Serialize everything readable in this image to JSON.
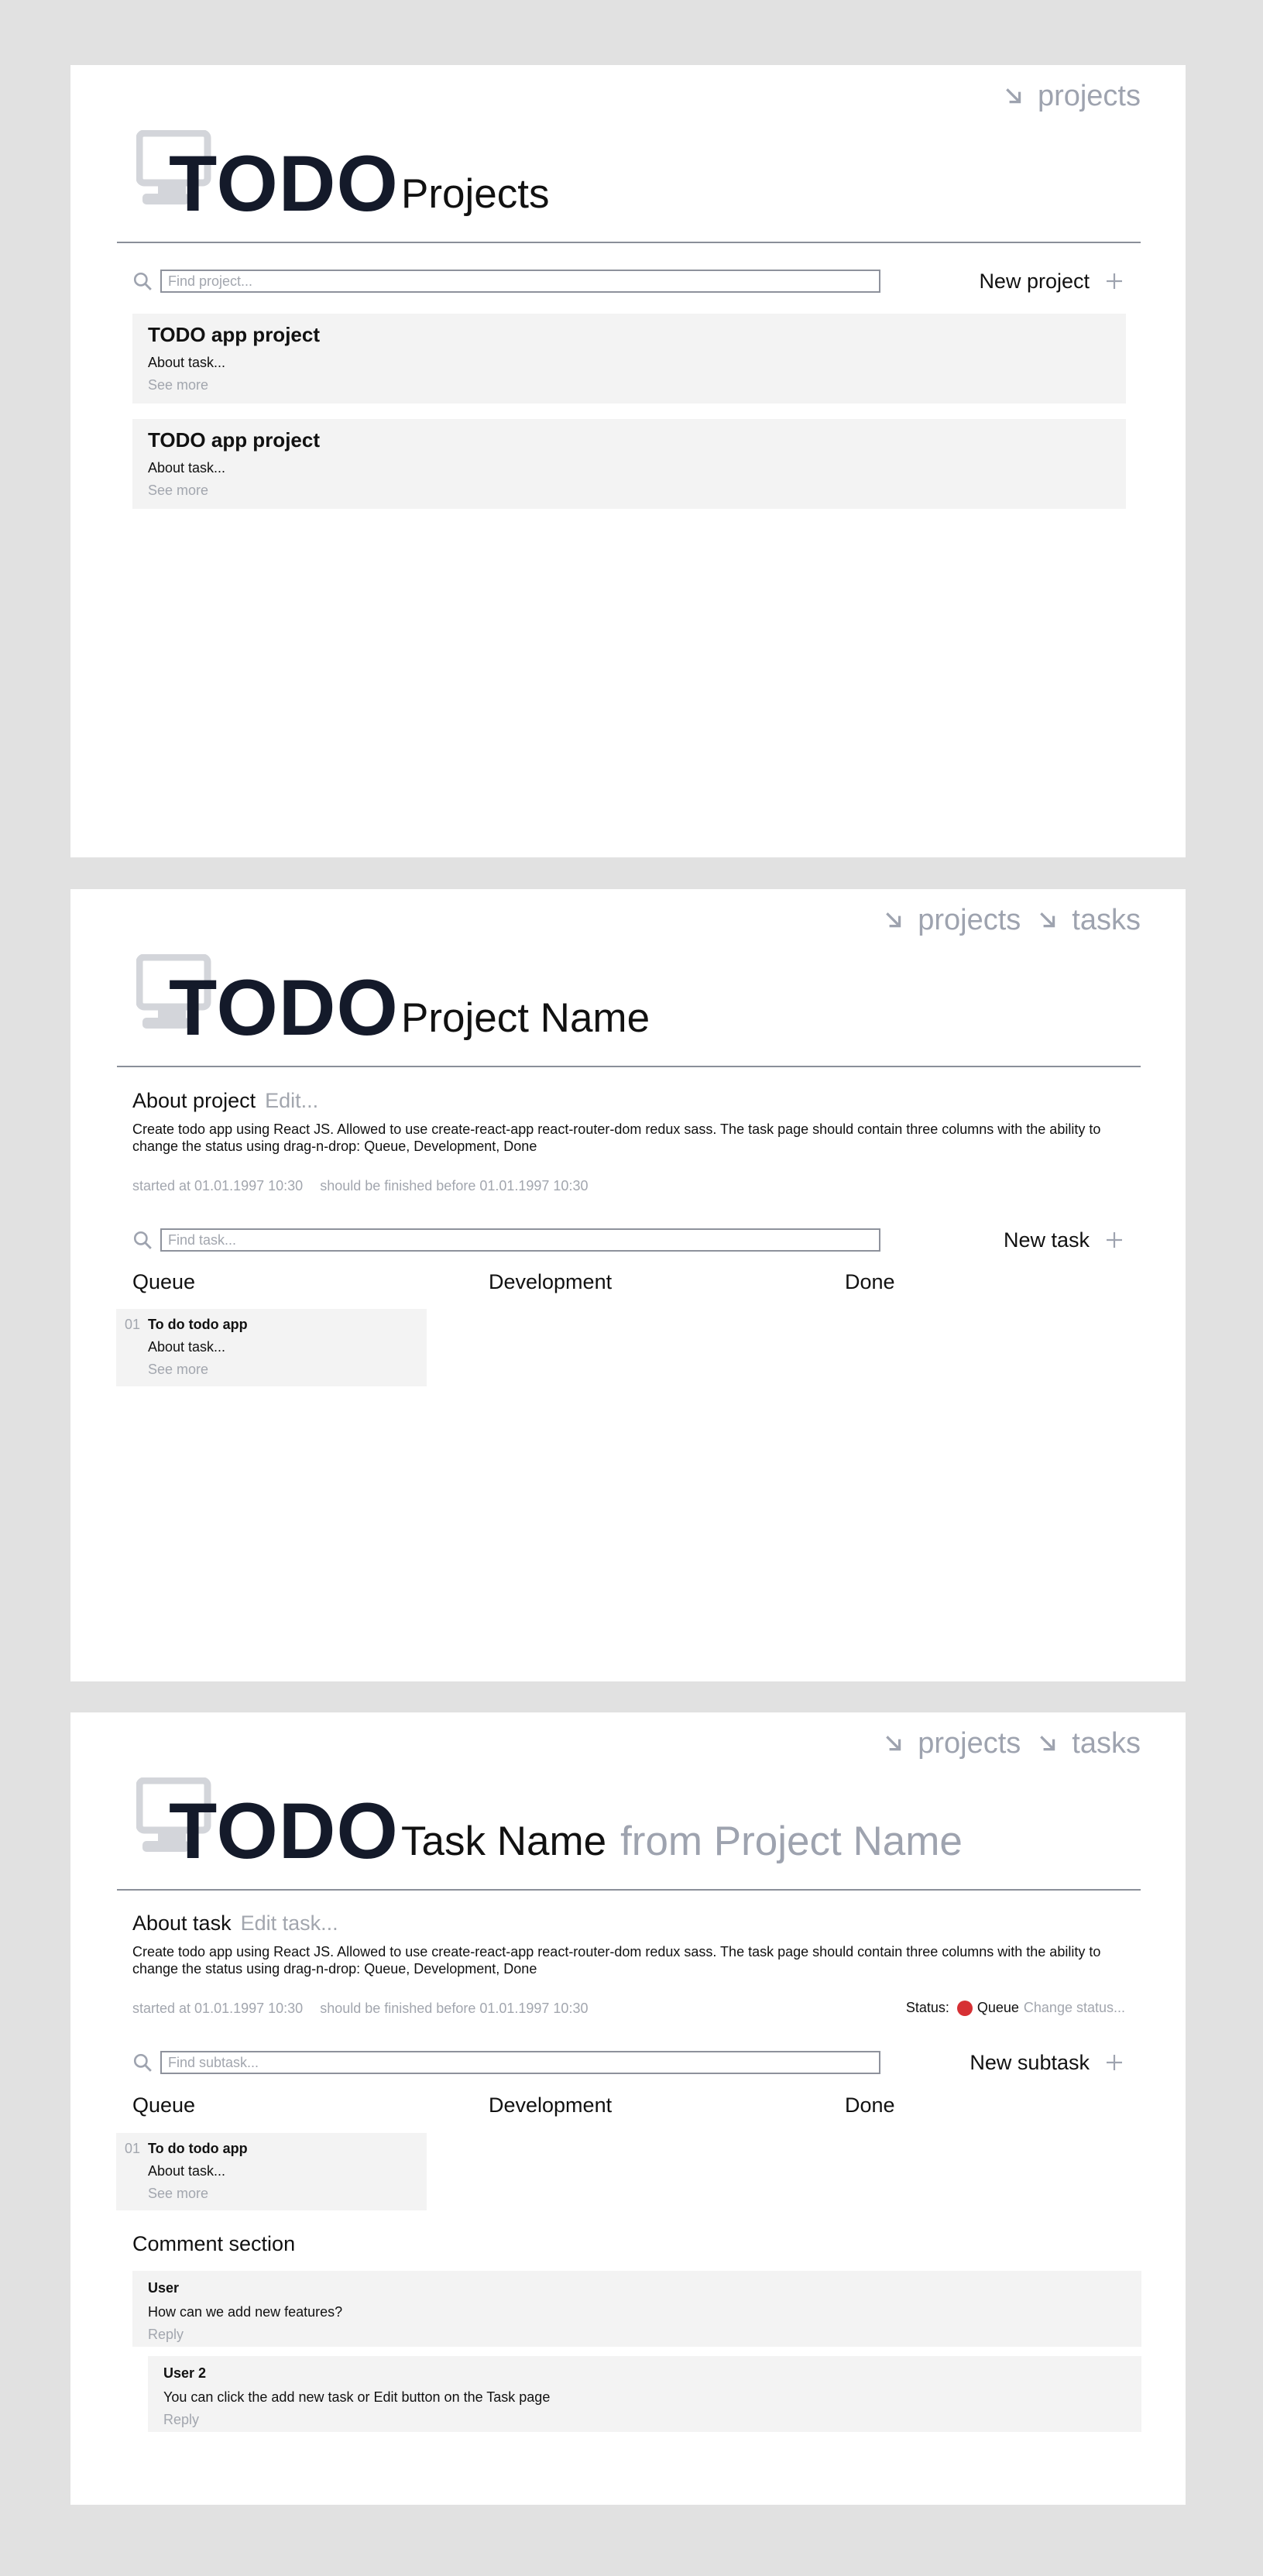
{
  "app": {
    "logo": "TODO"
  },
  "projects_page": {
    "nav": [
      "projects"
    ],
    "title": "Projects",
    "search_placeholder": "Find project...",
    "new_button": "New project",
    "projects": [
      {
        "title": "TODO app project",
        "about": "About task...",
        "more": "See more"
      },
      {
        "title": "TODO app project",
        "about": "About task...",
        "more": "See more"
      }
    ]
  },
  "project_page": {
    "nav": [
      "projects",
      "tasks"
    ],
    "title": "Project Name",
    "about_label": "About project",
    "edit_label": "Edit...",
    "description": "Create todo app using React JS. Allowed to use  create-react-app react-router-dom redux sass. The task page should contain three columns with the ability to change the status using drag-n-drop: Queue, Development, Done",
    "started": "started at 01.01.1997 10:30",
    "deadline": "should be finished before 01.01.1997 10:30",
    "search_placeholder": "Find task...",
    "new_button": "New task",
    "columns": [
      "Queue",
      "Development",
      "Done"
    ],
    "tasks": [
      {
        "num": "01",
        "title": "To do todo app",
        "about": "About task...",
        "more": "See more"
      }
    ]
  },
  "task_page": {
    "nav": [
      "projects",
      "tasks"
    ],
    "title": "Task Name",
    "subtitle": "from Project Name",
    "about_label": "About task",
    "edit_label": "Edit task...",
    "description": "Create todo app using React JS. Allowed to use  create-react-app react-router-dom redux sass. The task page should contain three columns with the ability to change the status using drag-n-drop: Queue, Development, Done",
    "started": "started at 01.01.1997 10:30",
    "deadline": "should be finished before 01.01.1997 10:30",
    "status_label": "Status:",
    "status_value": "Queue",
    "status_color": "#d63034",
    "change_status": "Change status...",
    "search_placeholder": "Find subtask...",
    "new_button": "New subtask",
    "columns": [
      "Queue",
      "Development",
      "Done"
    ],
    "subtasks": [
      {
        "num": "01",
        "title": "To do todo app",
        "about": "About task...",
        "more": "See more"
      }
    ],
    "comment_section_label": "Comment section",
    "comments": [
      {
        "user": "User",
        "text": "How can we add new features?",
        "reply": "Reply"
      },
      {
        "user": "User 2",
        "text": "You can click the add new task or Edit button on the Task page",
        "reply": "Reply"
      }
    ]
  }
}
